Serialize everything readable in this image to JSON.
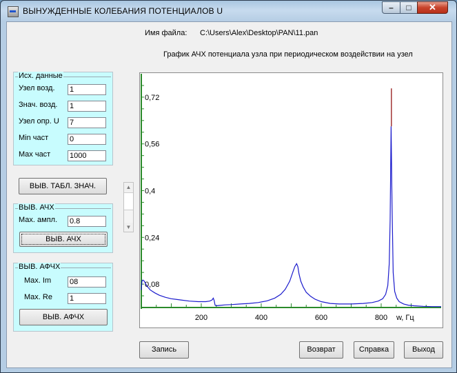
{
  "window": {
    "title": "ВЫНУЖДЕННЫЕ КОЛЕБАНИЯ ПОТЕНЦИАЛОВ   U"
  },
  "header": {
    "file_label": "Имя файла:",
    "file_path": "C:\\Users\\Alex\\Desktop\\PAN\\11.pan",
    "graph_title": "График АЧХ  потенциала  узла при периодическом воздействии на узел"
  },
  "inputs": {
    "title": "Исх. данные",
    "node_label": "Узел  возд.",
    "node_value": "1",
    "value_label": "Знач. возд.",
    "value_value": "1",
    "node_u_label": "Узел опр. U",
    "node_u_value": "7",
    "fmin_label": "Min част",
    "fmin_value": "0",
    "fmax_label": "Max част",
    "fmax_value": "1000"
  },
  "table_button": "ВЫВ. ТАБЛ. ЗНАЧ.",
  "afc": {
    "title": "ВЫВ. АЧХ",
    "amp_label": "Мах. ампл.",
    "amp_value": "0.8",
    "button": "ВЫВ. АЧХ"
  },
  "apfc": {
    "title": "ВЫВ. АФЧХ",
    "im_label": "Max. Im",
    "im_value": "08",
    "re_label": "Max. Re",
    "re_value": "1",
    "button": "ВЫВ. АФЧХ"
  },
  "bottom_buttons": {
    "save": "Запись",
    "back": "Возврат",
    "help": "Справка",
    "exit": "Выход"
  },
  "colors": {
    "panel": "#c8fcfe",
    "curve": "#1a1acc",
    "axis": "#2a8a2a",
    "peak": "#8b0000"
  },
  "chart_data": {
    "type": "line",
    "title": "",
    "xlabel": "w, Гц",
    "ylabel": "",
    "xlim": [
      0,
      1000
    ],
    "ylim": [
      0,
      0.8
    ],
    "x_ticks": [
      200,
      400,
      600,
      800
    ],
    "y_ticks": [
      0.08,
      0.24,
      0.4,
      0.56,
      0.72
    ],
    "y_tick_labels": [
      "0,08",
      "0,24",
      "0,4",
      "0,56",
      "0,72"
    ],
    "series": [
      {
        "x": [
          0,
          2,
          5,
          10,
          15,
          20,
          30,
          45,
          60,
          80,
          100,
          130,
          160,
          190,
          215,
          228,
          236,
          240,
          243,
          246,
          250,
          260,
          280,
          300,
          330,
          360,
          390,
          420,
          445,
          465,
          480,
          495,
          505,
          512,
          518,
          522,
          526,
          532,
          540,
          550,
          565,
          580,
          600,
          630,
          660,
          700,
          740,
          770,
          790,
          805,
          815,
          822,
          827,
          830,
          833,
          836,
          840,
          845,
          852,
          860,
          875,
          890,
          910,
          940,
          970,
          1000
        ],
        "y": [
          0.06,
          0.09,
          0.094,
          0.09,
          0.08,
          0.072,
          0.06,
          0.05,
          0.042,
          0.035,
          0.03,
          0.026,
          0.022,
          0.02,
          0.02,
          0.022,
          0.026,
          0.032,
          0.024,
          0.008,
          0.006,
          0.007,
          0.009,
          0.01,
          0.012,
          0.014,
          0.017,
          0.023,
          0.032,
          0.045,
          0.062,
          0.09,
          0.12,
          0.14,
          0.15,
          0.14,
          0.115,
          0.09,
          0.07,
          0.052,
          0.038,
          0.028,
          0.02,
          0.014,
          0.012,
          0.012,
          0.014,
          0.017,
          0.022,
          0.03,
          0.045,
          0.075,
          0.15,
          0.3,
          0.62,
          0.36,
          0.12,
          0.055,
          0.032,
          0.02,
          0.012,
          0.008,
          0.006,
          0.004,
          0.003,
          0.003
        ]
      }
    ],
    "peak_marker": {
      "x": 833,
      "y": 0.75
    }
  }
}
